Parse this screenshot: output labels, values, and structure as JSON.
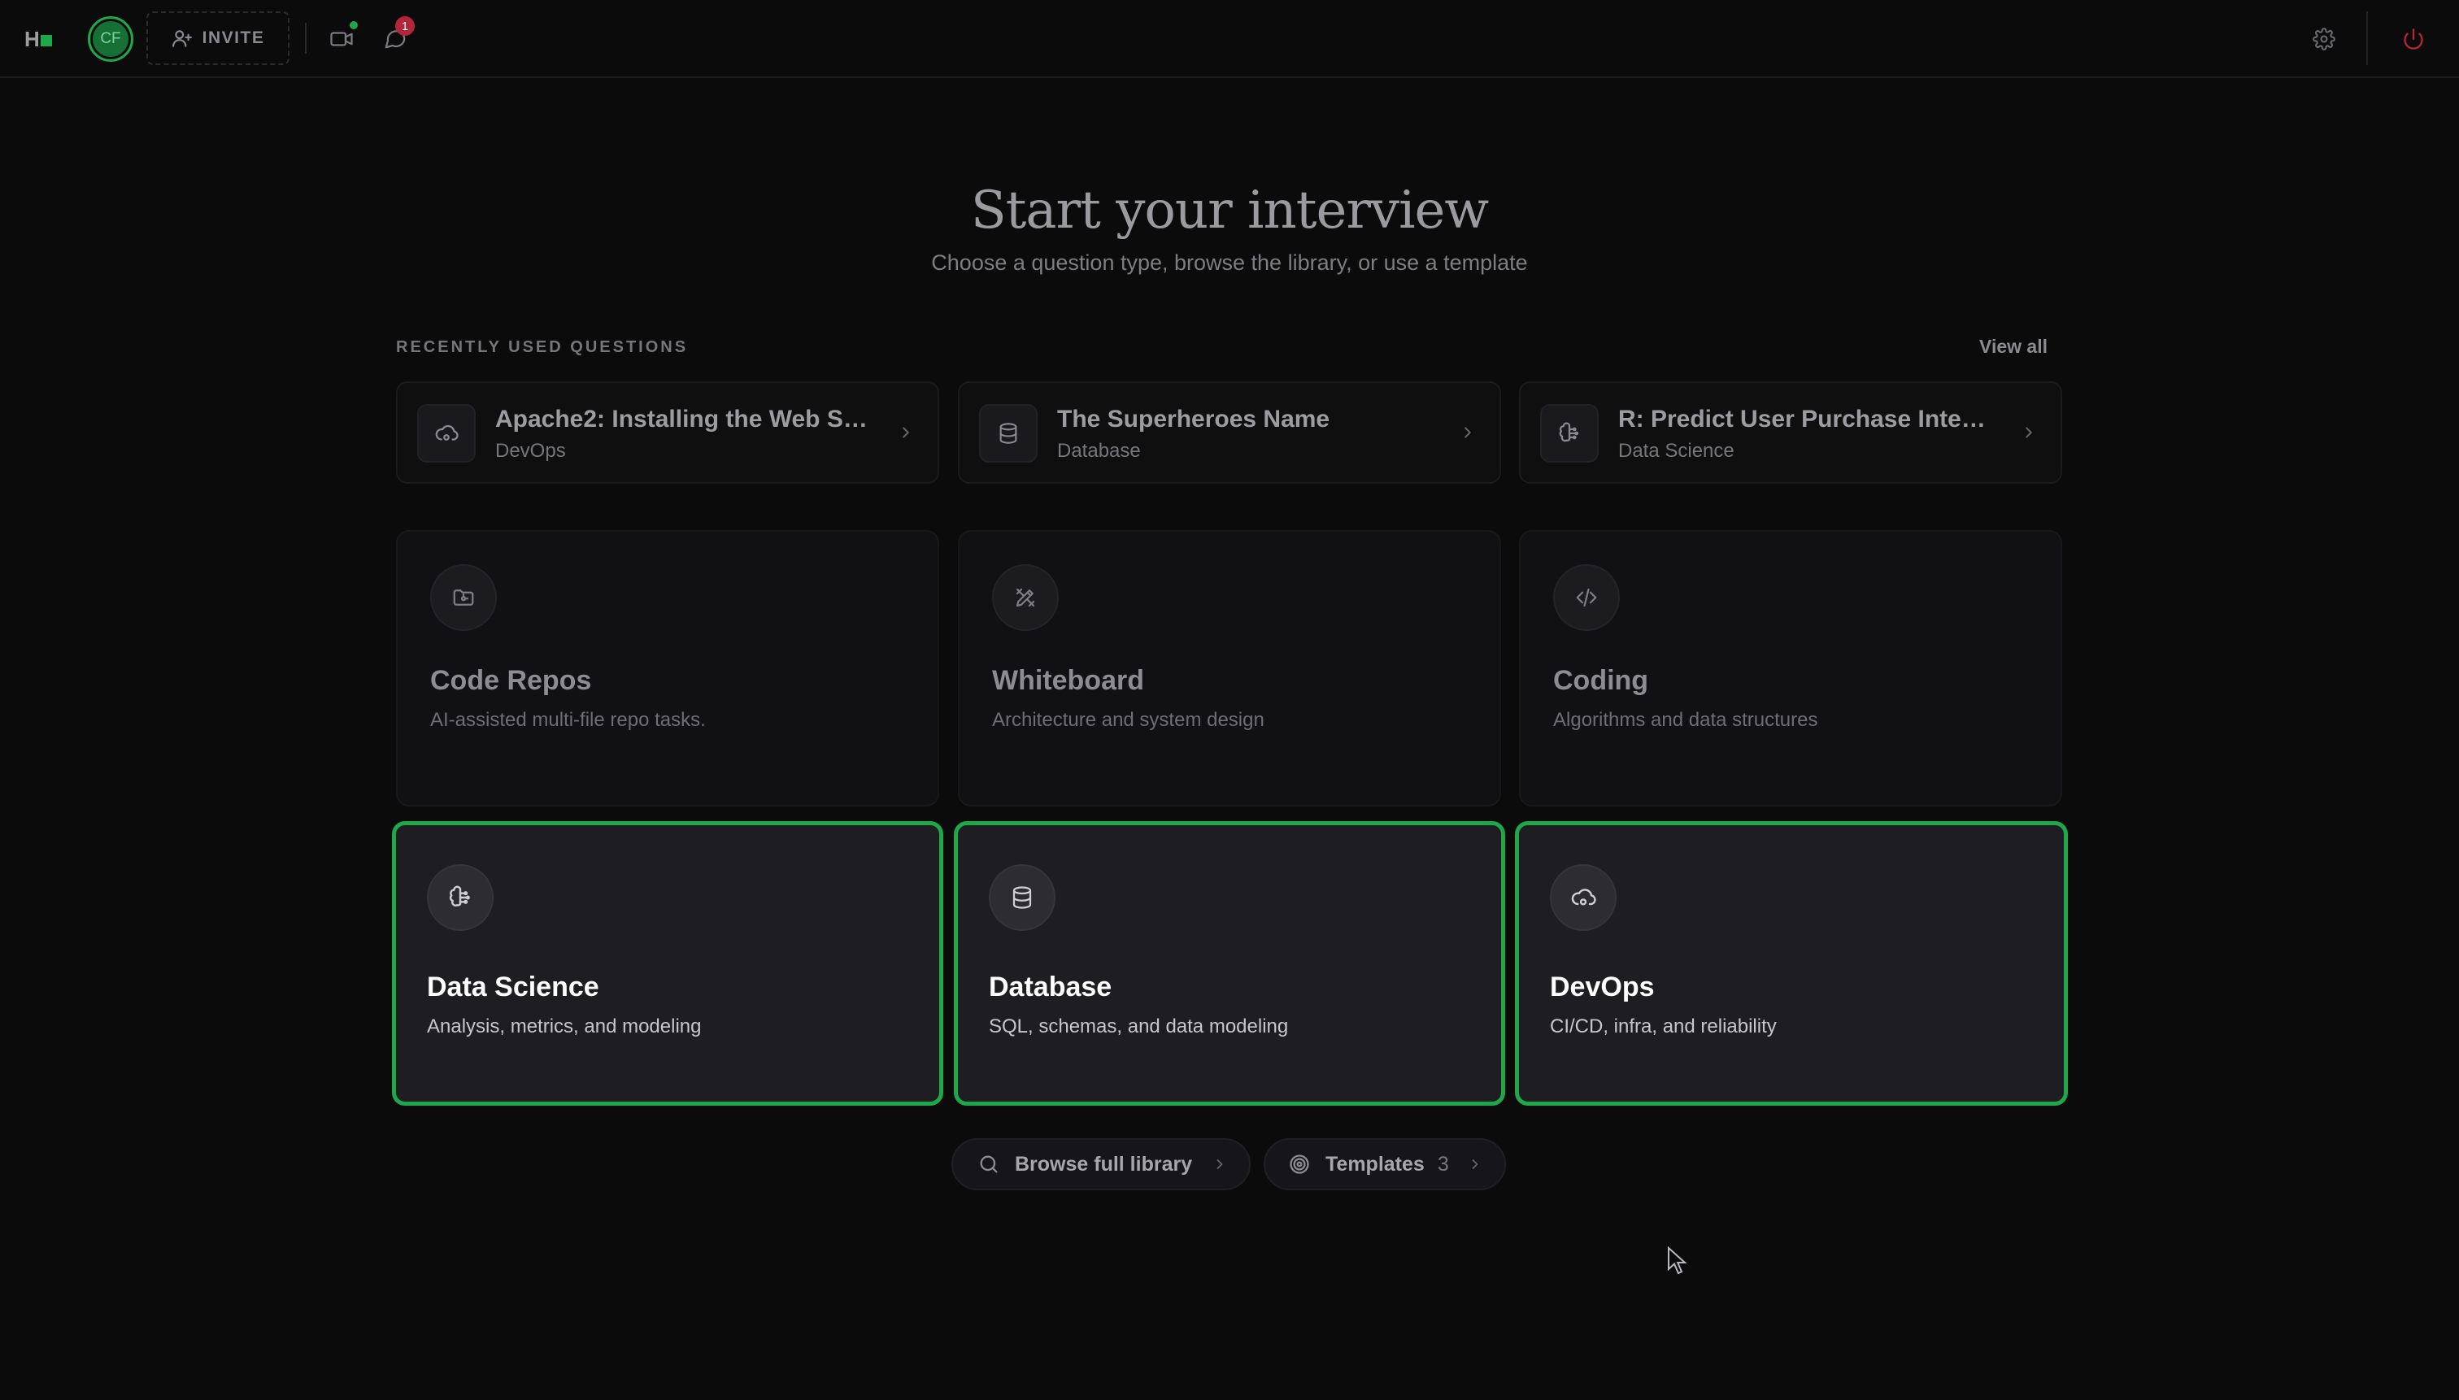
{
  "app": {
    "logo_text": "H",
    "user_initials": "CF",
    "invite_label": "INVITE",
    "notification_count": "1",
    "video_online": true,
    "brand_green": "#1fa84a",
    "danger_red": "#b3263a"
  },
  "hero": {
    "title": "Start your interview",
    "subtitle": "Choose a question type, browse the library, or use a template"
  },
  "recent": {
    "label": "RECENTLY USED QUESTIONS",
    "view_all": "View all",
    "items": [
      {
        "title": "Apache2: Installing the Web Ser...",
        "subtitle": "DevOps",
        "icon": "cloud-cog-icon"
      },
      {
        "title": "The Superheroes Name",
        "subtitle": "Database",
        "icon": "database-icon"
      },
      {
        "title": "R: Predict User Purchase Intenti...",
        "subtitle": "Data Science",
        "icon": "brain-icon"
      }
    ]
  },
  "types": [
    {
      "title": "Code Repos",
      "desc": "AI-assisted multi-file repo tasks.",
      "icon": "folder-git-icon",
      "highlighted": false
    },
    {
      "title": "Whiteboard",
      "desc": "Architecture and system design",
      "icon": "drafting-pencil-icon",
      "highlighted": false
    },
    {
      "title": "Coding",
      "desc": "Algorithms and data structures",
      "icon": "code-icon",
      "highlighted": false
    },
    {
      "title": "Data Science",
      "desc": "Analysis, metrics, and modeling",
      "icon": "brain-icon",
      "highlighted": true
    },
    {
      "title": "Database",
      "desc": "SQL, schemas, and data modeling",
      "icon": "database-icon",
      "highlighted": true
    },
    {
      "title": "DevOps",
      "desc": "CI/CD, infra, and reliability",
      "icon": "cloud-cog-icon",
      "highlighted": true
    }
  ],
  "actions": {
    "browse_label": "Browse full library",
    "templates_label": "Templates",
    "templates_count": "3"
  }
}
